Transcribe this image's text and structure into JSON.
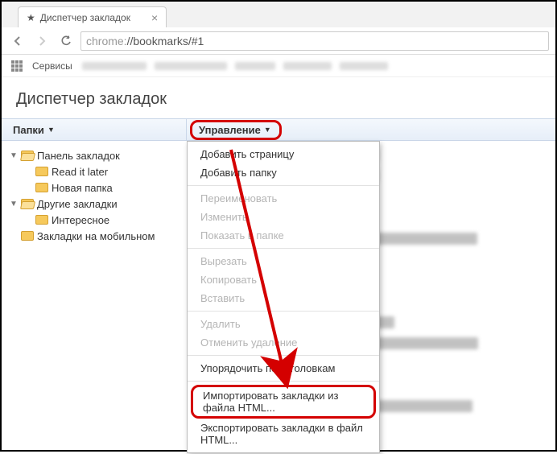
{
  "tab": {
    "title": "Диспетчер закладок"
  },
  "omnibox": {
    "prefix": "chrome:",
    "path": "//bookmarks/#1"
  },
  "appsbar": {
    "services": "Сервисы"
  },
  "page": {
    "title": "Диспетчер закладок"
  },
  "headers": {
    "folders": "Папки",
    "manage": "Управление"
  },
  "tree": {
    "n0": "Панель закладок",
    "n0_0": "Read it later",
    "n0_1": "Новая папка",
    "n1": "Другие закладки",
    "n1_0": "Интересное",
    "n2": "Закладки на мобильном"
  },
  "menu": {
    "add_page": "Добавить страницу",
    "add_folder": "Добавить папку",
    "rename": "Переименовать",
    "edit": "Изменить",
    "show_in_folder": "Показать в папке",
    "cut": "Вырезать",
    "copy": "Копировать",
    "paste": "Вставить",
    "delete": "Удалить",
    "undo_delete": "Отменить удаление",
    "sort": "Упорядочить по заголовкам",
    "import_html": "Импортировать закладки из файла HTML...",
    "export_html": "Экспортировать закладки в файл HTML..."
  }
}
